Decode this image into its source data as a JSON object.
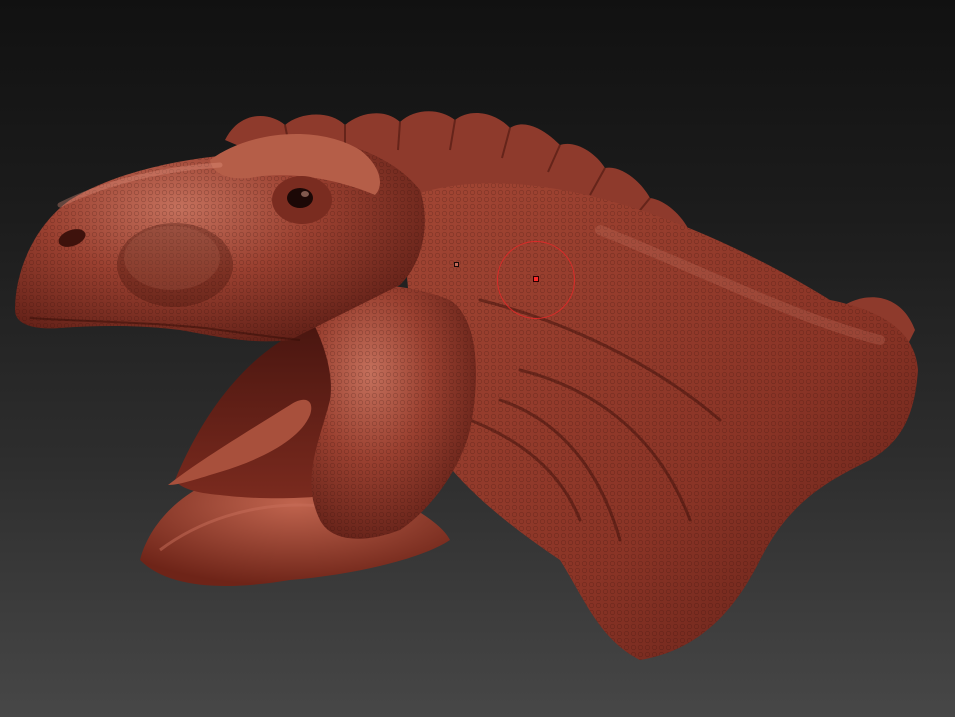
{
  "canvas": {
    "background_top": "#111111",
    "background_bottom": "#474747"
  },
  "model": {
    "material_color": "#9a3f30",
    "highlight_color": "#c8705c",
    "shadow_color": "#4a1812"
  },
  "brush": {
    "ring_color": "#e62828",
    "center_color": "#ff2a2a"
  }
}
